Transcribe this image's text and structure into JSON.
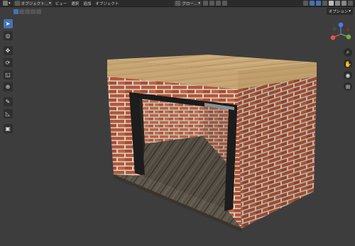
{
  "header": {
    "editor_type_icon": "viewport-editor-icon",
    "mode_label": "オブジェクト...",
    "menus": [
      "ビュー",
      "選択",
      "追加",
      "オブジェクト"
    ],
    "transform_orientation": "グロー...",
    "snap_icon": "snap-icon",
    "proportional_icon": "proportional-edit-icon"
  },
  "options_label": "オプション",
  "toolbar_tools": [
    "select-box",
    "cursor",
    "move",
    "rotate",
    "scale",
    "transform",
    "annotate",
    "measure",
    "add-cube"
  ],
  "nav_icons": [
    "zoom-icon",
    "hand-icon",
    "camera-icon",
    "grid-icon"
  ],
  "colors": {
    "viewport_bg": "#3d3d3d",
    "header_bg": "#2b2b2b",
    "accent": "#4772b3",
    "brick": "#b5583b",
    "mortar": "#d6d0c2",
    "wood_top": "#c8a676",
    "floor": "#5a534a",
    "frame": "#1e1e1e"
  }
}
